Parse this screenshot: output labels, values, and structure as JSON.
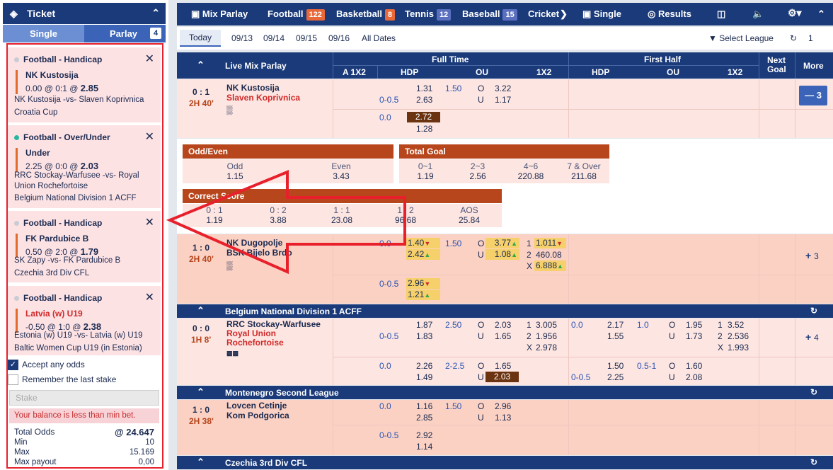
{
  "ticket": {
    "title": "Ticket",
    "tab_single": "Single",
    "tab_parlay": "Parlay",
    "parlay_count": "4"
  },
  "bets": [
    {
      "market": "Football - Handicap",
      "selection": "NK Kustosija",
      "line": "0.00 @ 0:1 @",
      "odds": "2.85",
      "match": "NK Kustosija -vs- Slaven Koprivnica",
      "league": "Croatia Cup"
    },
    {
      "market": "Football - Over/Under",
      "selection": "Under",
      "line": "2.25 @ 0:0 @",
      "odds": "2.03",
      "match": "RRC Stockay-Warfusee -vs- Royal Union Rochefortoise",
      "league": "Belgium National Division 1 ACFF"
    },
    {
      "market": "Football - Handicap",
      "selection": "FK Pardubice B",
      "line": "0.50 @ 2:0 @",
      "odds": "1.79",
      "match": "SK Zapy -vs- FK Pardubice B",
      "league": "Czechia 3rd Div CFL"
    },
    {
      "market": "Football - Handicap",
      "selection": "Latvia (w) U19",
      "line": "-0.50 @ 1:0 @",
      "odds": "2.38",
      "match": "Estonia (w) U19 -vs- Latvia (w) U19",
      "league": "Baltic Women Cup U19 (in Estonia)"
    }
  ],
  "options": {
    "accept": "Accept any odds",
    "remember": "Remember the last stake",
    "stake_placeholder": "Stake",
    "warning": "Your balance is less than min bet."
  },
  "summary": {
    "total_odds_label": "Total Odds",
    "total_odds": "@ 24.647",
    "min_label": "Min",
    "min": "10",
    "max_label": "Max",
    "max": "15.169",
    "payout_label": "Max payout",
    "payout": "0,00"
  },
  "nav": {
    "mix": "Mix Parlay",
    "football": "Football",
    "football_n": "122",
    "basketball": "Basketball",
    "basketball_n": "8",
    "tennis": "Tennis",
    "tennis_n": "12",
    "baseball": "Baseball",
    "baseball_n": "15",
    "cricket": "Cricket",
    "single": "Single",
    "results": "Results"
  },
  "dates": {
    "today": "Today",
    "d1": "09/13",
    "d2": "09/14",
    "d3": "09/15",
    "d4": "09/16",
    "all": "All Dates",
    "select_league": "Select League",
    "refresh_count": "1"
  },
  "head": {
    "live": "Live Mix Parlay",
    "full_time": "Full Time",
    "first_half": "First Half",
    "a1x2": "A 1X2",
    "hdp": "HDP",
    "ou": "OU",
    "x12": "1X2",
    "next_goal": "Next Goal",
    "more": "More"
  },
  "m1": {
    "score": "0 : 1",
    "time": "2H 40'",
    "home": "NK Kustosija",
    "away": "Slaven Koprivnica",
    "hdp1": "0-0.5",
    "h1": "1.31",
    "h2": "2.63",
    "ou1": "1.50",
    "o": "O",
    "u": "U",
    "o1": "3.22",
    "u1": "1.17",
    "hdp2": "0.0",
    "h3": "2.72",
    "h4": "1.28",
    "more": "3"
  },
  "oddeven": {
    "title": "Odd/Even",
    "odd": "Odd",
    "even": "Even",
    "odd_v": "1.15",
    "even_v": "3.43"
  },
  "totalgoal": {
    "title": "Total Goal",
    "c1": "0~1",
    "c2": "2~3",
    "c3": "4~6",
    "c4": "7 & Over",
    "v1": "1.19",
    "v2": "2.56",
    "v3": "220.88",
    "v4": "211.68"
  },
  "correct": {
    "title": "Correct Score",
    "c1": "0 : 1",
    "c2": "0 : 2",
    "c3": "1 : 1",
    "c4": "1 : 2",
    "c5": "AOS",
    "v1": "1.19",
    "v2": "3.88",
    "v3": "23.08",
    "v4": "96.68",
    "v5": "25.84"
  },
  "m2": {
    "score": "1 : 0",
    "time": "2H 40'",
    "home": "NK Dugopolje",
    "away": "BSK Bijelo Brdo",
    "hdp1": "0.0",
    "h1": "1.40",
    "h2": "2.42",
    "ou1": "1.50",
    "o1": "3.77",
    "u1": "1.08",
    "x1": "1",
    "x2": "2",
    "x3": "X",
    "x1v": "1.011",
    "x2v": "460.08",
    "x3v": "6.888",
    "hdp2": "0-0.5",
    "h3": "2.96",
    "h4": "1.21",
    "more": "3"
  },
  "s1": {
    "title": "Belgium National Division 1 ACFF"
  },
  "m3": {
    "score": "0 : 0",
    "time": "1H 8'",
    "home": "RRC Stockay-Warfusee",
    "away": "Royal Union Rochefortoise",
    "hdp1": "0-0.5",
    "h1": "1.87",
    "h2": "1.83",
    "ou1": "2.50",
    "o1": "2.03",
    "u1": "1.65",
    "x1v": "3.005",
    "x2v": "1.956",
    "x3v": "2.978",
    "fh_hdp": "0.0",
    "fh1": "2.17",
    "fh2": "1.55",
    "fh_ou": "1.0",
    "fho": "1.95",
    "fhu": "1.73",
    "fhx1": "3.52",
    "fhx2": "2.536",
    "fhx3": "1.993",
    "hdp2": "0.0",
    "h3": "2.26",
    "h4": "1.49",
    "ou2": "2-2.5",
    "o2": "1.65",
    "u2": "2.03",
    "fh_hdp2a": "0-0.5",
    "fh3": "1.50",
    "fh4": "2.25",
    "fh_ou2": "0.5-1",
    "fho2": "1.60",
    "fhu2": "2.08",
    "more": "4"
  },
  "s2": {
    "title": "Montenegro Second League"
  },
  "m4": {
    "score": "1 : 0",
    "time": "2H 38'",
    "home": "Lovcen Cetinje",
    "away": "Kom Podgorica",
    "hdp1": "0.0",
    "h1": "1.16",
    "h2": "2.85",
    "ou1": "1.50",
    "o1": "2.96",
    "u1": "1.13",
    "hdp2": "0-0.5",
    "h3": "2.92",
    "h4": "1.14"
  },
  "s3": {
    "title": "Czechia 3rd Div CFL"
  }
}
